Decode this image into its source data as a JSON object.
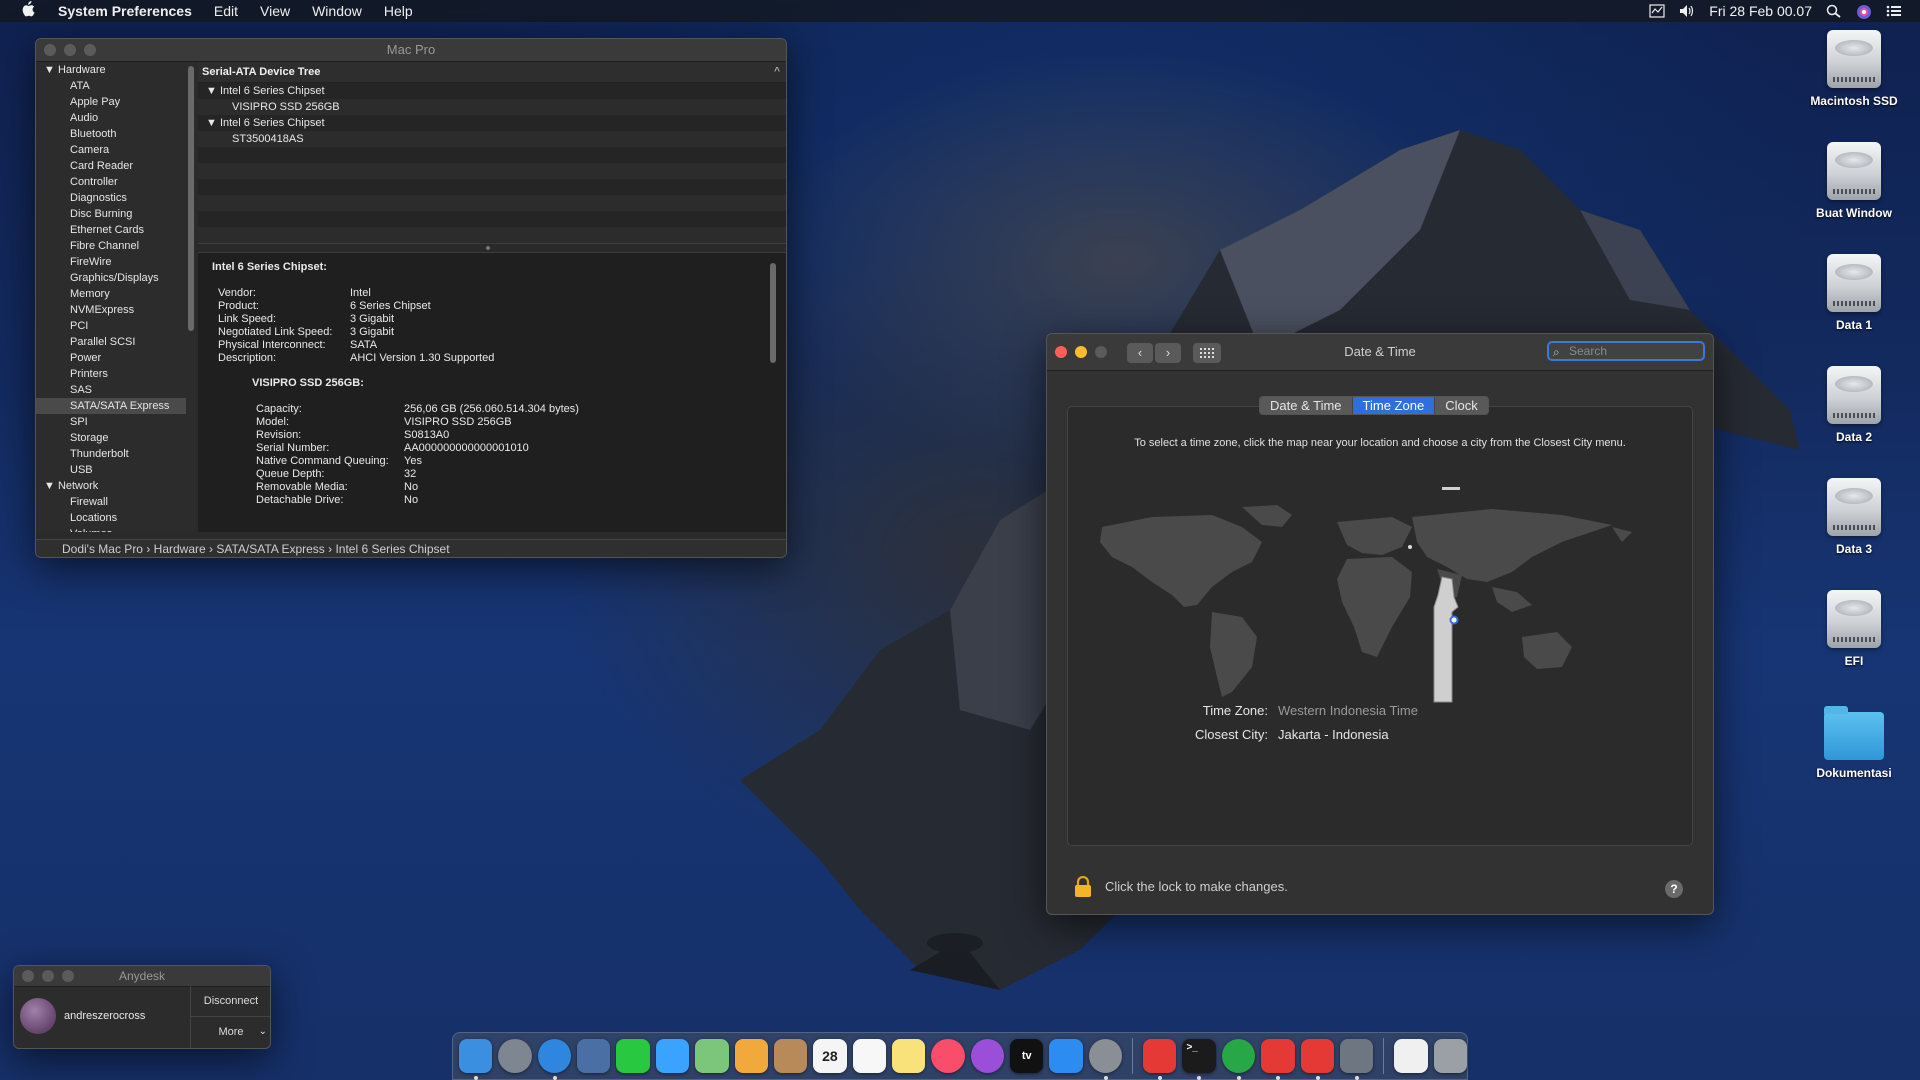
{
  "menubar": {
    "app_name": "System Preferences",
    "menus": [
      "Edit",
      "View",
      "Window",
      "Help"
    ],
    "clock": "Fri 28 Feb  00.07",
    "status_icons": [
      "activity-monitor-icon",
      "volume-icon",
      "spotlight-icon",
      "siri-icon",
      "notification-center-icon"
    ]
  },
  "desktop_icons": [
    {
      "label": "Macintosh SSD",
      "kind": "drive"
    },
    {
      "label": "Buat Window",
      "kind": "drive"
    },
    {
      "label": "Data 1",
      "kind": "drive"
    },
    {
      "label": "Data 2",
      "kind": "drive"
    },
    {
      "label": "Data 3",
      "kind": "drive"
    },
    {
      "label": "EFI",
      "kind": "drive"
    },
    {
      "label": "Dokumentasi",
      "kind": "folder"
    }
  ],
  "sysinfo": {
    "title": "Mac Pro",
    "sidebar": [
      {
        "label": "▼ Hardware",
        "group": true
      },
      {
        "label": "ATA"
      },
      {
        "label": "Apple Pay"
      },
      {
        "label": "Audio"
      },
      {
        "label": "Bluetooth"
      },
      {
        "label": "Camera"
      },
      {
        "label": "Card Reader"
      },
      {
        "label": "Controller"
      },
      {
        "label": "Diagnostics"
      },
      {
        "label": "Disc Burning"
      },
      {
        "label": "Ethernet Cards"
      },
      {
        "label": "Fibre Channel"
      },
      {
        "label": "FireWire"
      },
      {
        "label": "Graphics/Displays"
      },
      {
        "label": "Memory"
      },
      {
        "label": "NVMExpress"
      },
      {
        "label": "PCI"
      },
      {
        "label": "Parallel SCSI"
      },
      {
        "label": "Power"
      },
      {
        "label": "Printers"
      },
      {
        "label": "SAS"
      },
      {
        "label": "SATA/SATA Express",
        "selected": true
      },
      {
        "label": "SPI"
      },
      {
        "label": "Storage"
      },
      {
        "label": "Thunderbolt"
      },
      {
        "label": "USB"
      },
      {
        "label": "▼ Network",
        "group": true
      },
      {
        "label": "Firewall"
      },
      {
        "label": "Locations"
      },
      {
        "label": "Volumes"
      }
    ],
    "tree_header": "Serial-ATA Device Tree",
    "tree": [
      {
        "label": "▼ Intel 6 Series Chipset",
        "child": false
      },
      {
        "label": "VISIPRO SSD 256GB",
        "child": true
      },
      {
        "label": "▼ Intel 6 Series Chipset",
        "child": false
      },
      {
        "label": "ST3500418AS",
        "child": true
      }
    ],
    "detail_heading": "Intel 6 Series Chipset:",
    "chipset_props": [
      {
        "k": "Vendor:",
        "v": "Intel"
      },
      {
        "k": "Product:",
        "v": "6 Series Chipset"
      },
      {
        "k": "Link Speed:",
        "v": "3 Gigabit"
      },
      {
        "k": "Negotiated Link Speed:",
        "v": "3 Gigabit"
      },
      {
        "k": "Physical Interconnect:",
        "v": "SATA"
      },
      {
        "k": "Description:",
        "v": "AHCI Version 1.30 Supported"
      }
    ],
    "drive_heading": "VISIPRO SSD 256GB:",
    "drive_props": [
      {
        "k": "Capacity:",
        "v": "256,06 GB (256.060.514.304 bytes)"
      },
      {
        "k": "Model:",
        "v": "VISIPRO SSD 256GB"
      },
      {
        "k": "Revision:",
        "v": "S0813A0"
      },
      {
        "k": "Serial Number:",
        "v": "AA000000000000001010"
      },
      {
        "k": "Native Command Queuing:",
        "v": "Yes"
      },
      {
        "k": "Queue Depth:",
        "v": "32"
      },
      {
        "k": "Removable Media:",
        "v": "No"
      },
      {
        "k": "Detachable Drive:",
        "v": "No"
      }
    ],
    "path": "Dodi's Mac Pro › Hardware › SATA/SATA Express › Intel 6 Series Chipset"
  },
  "datetime": {
    "title": "Date & Time",
    "search_placeholder": "Search",
    "tabs": [
      {
        "label": "Date & Time",
        "active": false
      },
      {
        "label": "Time Zone",
        "active": true
      },
      {
        "label": "Clock",
        "active": false
      }
    ],
    "instruction": "To select a time zone, click the map near your location and choose a city from the Closest City menu.",
    "time_zone_label": "Time Zone:",
    "time_zone_value": "Western Indonesia Time",
    "closest_city_label": "Closest City:",
    "closest_city_value": "Jakarta - Indonesia",
    "lock_text": "Click the lock to make changes.",
    "help": "?"
  },
  "anydesk": {
    "title": "Anydesk",
    "user": "andreszerocross",
    "disconnect": "Disconnect",
    "more": "More"
  },
  "dock": {
    "calendar_day": "28",
    "tv_label": "tv",
    "items": [
      {
        "name": "finder-icon",
        "color": "#3a8fe0",
        "running": true
      },
      {
        "name": "launchpad-icon",
        "color": "#7d8691",
        "running": false
      },
      {
        "name": "safari-icon",
        "color": "#2e86de",
        "running": true
      },
      {
        "name": "preview-icon",
        "color": "#4a6fa5",
        "running": false
      },
      {
        "name": "facetime-icon",
        "color": "#28c840",
        "running": false
      },
      {
        "name": "messages-icon",
        "color": "#3aa2ff",
        "running": false
      },
      {
        "name": "maps-icon",
        "color": "#7bc67b",
        "running": false
      },
      {
        "name": "photos-icon",
        "color": "#f2a93b",
        "running": false
      },
      {
        "name": "contacts-icon",
        "color": "#b88a5a",
        "running": false
      },
      {
        "name": "calendar-icon",
        "color": "#f5f5f5",
        "running": false
      },
      {
        "name": "reminders-icon",
        "color": "#f7f7f7",
        "running": false
      },
      {
        "name": "notes-icon",
        "color": "#f9e27a",
        "running": false
      },
      {
        "name": "music-icon",
        "color": "#fa4d6a",
        "running": false
      },
      {
        "name": "podcasts-icon",
        "color": "#9b4fd8",
        "running": false
      },
      {
        "name": "tv-icon",
        "color": "#111111",
        "running": false
      },
      {
        "name": "app-store-icon",
        "color": "#2d8cf0",
        "running": false
      },
      {
        "name": "system-preferences-icon",
        "color": "#8a8f96",
        "running": true
      },
      {
        "name": "sep",
        "color": "",
        "running": false
      },
      {
        "name": "anydesk-icon",
        "color": "#e53935",
        "running": true
      },
      {
        "name": "terminal-icon",
        "color": "#1b1b1b",
        "running": true
      },
      {
        "name": "green-app-icon",
        "color": "#27a745",
        "running": true
      },
      {
        "name": "anydesk-icon-2",
        "color": "#e53935",
        "running": true
      },
      {
        "name": "anydesk-icon-3",
        "color": "#e53935",
        "running": true
      },
      {
        "name": "system-information-icon",
        "color": "#6e7681",
        "running": true
      },
      {
        "name": "sep",
        "color": "",
        "running": false
      },
      {
        "name": "document-icon",
        "color": "#f0f0f0",
        "running": false
      },
      {
        "name": "trash-icon",
        "color": "#9aa0a6",
        "running": false
      }
    ]
  }
}
